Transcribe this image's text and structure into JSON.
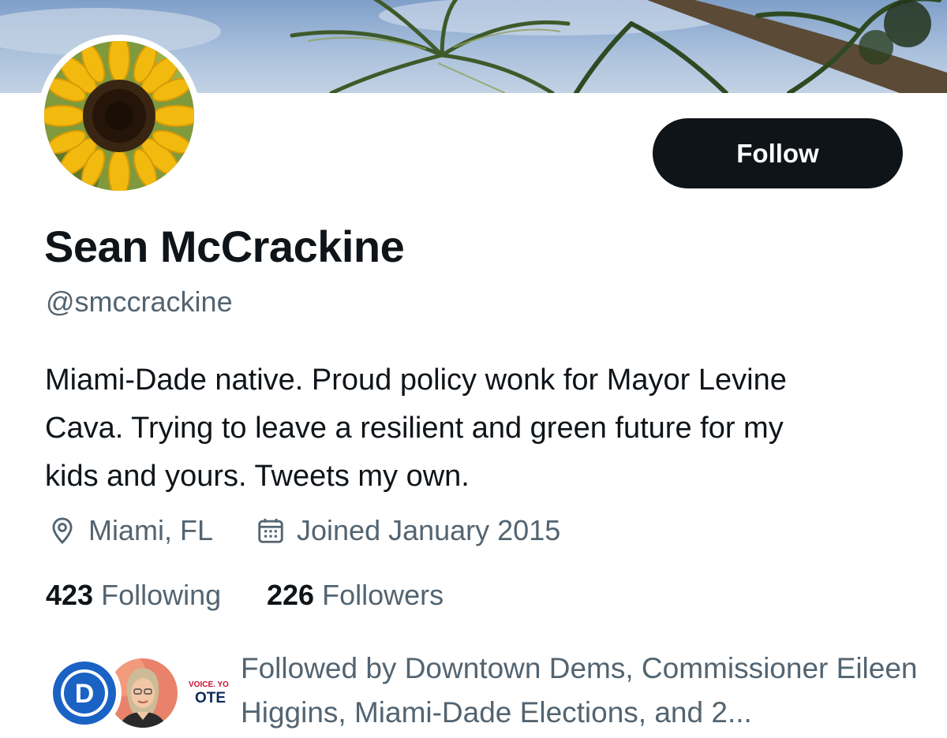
{
  "profile": {
    "display_name": "Sean McCrackine",
    "handle": "@smccrackine",
    "bio": "Miami-Dade native. Proud policy wonk for Mayor Levine Cava. Trying to leave a resilient and green future for my kids and yours. Tweets my own.",
    "location": "Miami, FL",
    "joined": "Joined January 2015"
  },
  "actions": {
    "follow_label": "Follow"
  },
  "stats": {
    "following_count": "423",
    "following_label": "Following",
    "followers_count": "226",
    "followers_label": "Followers"
  },
  "followed_by": {
    "text": "Followed by Downtown Dems, Commissioner Eileen Higgins, Miami-Dade Elections, and 2...",
    "avatars": [
      {
        "name": "Downtown Dems",
        "icon": "democrats-d-logo",
        "letter": "D"
      },
      {
        "name": "Commissioner Eileen Higgins",
        "icon": "person-photo"
      },
      {
        "name": "Miami-Dade Elections",
        "icon": "vote-logo",
        "lines": [
          "VOICE. YOUR",
          "OTE"
        ]
      }
    ]
  },
  "colors": {
    "text_primary": "#0f1419",
    "text_secondary": "#536471",
    "button_bg": "#0f1419",
    "button_text": "#ffffff",
    "dem_blue": "#1a62c4",
    "vote_red": "#c8102e"
  },
  "icons": {
    "location": "map-pin-icon",
    "joined": "calendar-icon"
  }
}
